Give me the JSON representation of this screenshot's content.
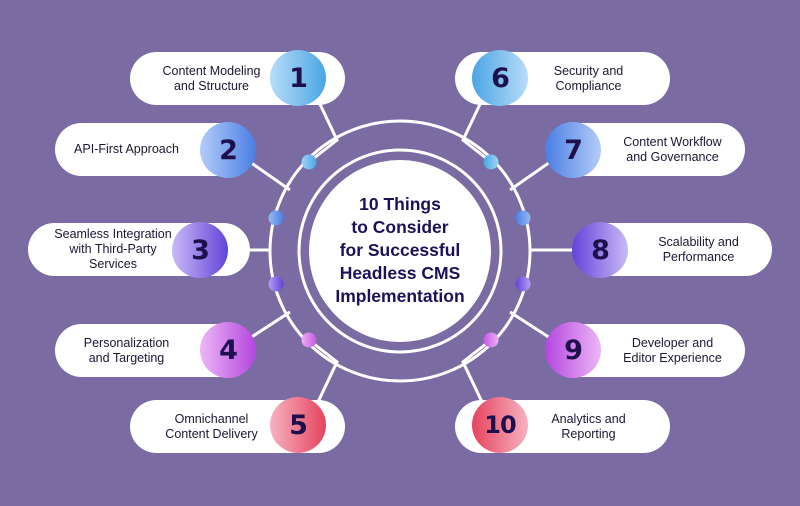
{
  "title": {
    "lines": [
      "10 Things",
      "to Consider",
      "for Successful",
      "Headless CMS",
      "Implementation"
    ]
  },
  "colors": {
    "background": "#7a6ba2",
    "title_text": "#1e1058",
    "number_text": "#1e0f4d",
    "pill": "#ffffff",
    "connector": "#ffffff"
  },
  "items": [
    {
      "number": "1",
      "lines": [
        "Content Modeling",
        "and Structure"
      ],
      "side": "left",
      "gradient": [
        "#b8dcf8",
        "#4aa6e4"
      ]
    },
    {
      "number": "2",
      "lines": [
        "API-First Approach"
      ],
      "side": "left",
      "gradient": [
        "#b4ccf8",
        "#4a7ee4"
      ]
    },
    {
      "number": "3",
      "lines": [
        "Seamless Integration",
        "with Third-Party",
        "Services"
      ],
      "side": "left",
      "gradient": [
        "#c9baf6",
        "#6244d9"
      ]
    },
    {
      "number": "4",
      "lines": [
        "Personalization",
        "and Targeting"
      ],
      "side": "left",
      "gradient": [
        "#ecb6f6",
        "#b446e0"
      ]
    },
    {
      "number": "5",
      "lines": [
        "Omnichannel",
        "Content Delivery"
      ],
      "side": "left",
      "gradient": [
        "#f7b2c2",
        "#e5445e"
      ]
    },
    {
      "number": "6",
      "lines": [
        "Security and",
        "Compliance"
      ],
      "side": "right",
      "gradient": [
        "#4aa6e4",
        "#b8dcf8"
      ]
    },
    {
      "number": "7",
      "lines": [
        "Content Workflow",
        "and Governance"
      ],
      "side": "right",
      "gradient": [
        "#4a7ee4",
        "#b4ccf8"
      ]
    },
    {
      "number": "8",
      "lines": [
        "Scalability and",
        "Performance"
      ],
      "side": "right",
      "gradient": [
        "#6244d9",
        "#c9baf6"
      ]
    },
    {
      "number": "9",
      "lines": [
        "Developer and",
        "Editor Experience"
      ],
      "side": "right",
      "gradient": [
        "#b446e0",
        "#ecb6f6"
      ]
    },
    {
      "number": "10",
      "lines": [
        "Analytics and",
        "Reporting"
      ],
      "side": "right",
      "gradient": [
        "#e5445e",
        "#f7b2c2"
      ]
    }
  ],
  "ring_dots": [
    {
      "gradient": [
        "#9fd4f6",
        "#4aa6e4"
      ]
    },
    {
      "gradient": [
        "#9ab8f4",
        "#4a7ee4"
      ]
    },
    {
      "gradient": [
        "#b09ef2",
        "#6244d9"
      ]
    },
    {
      "gradient": [
        "#eeb0f4",
        "#c356e2"
      ]
    },
    {
      "gradient": [
        "#4aa6e4",
        "#9fd4f6"
      ]
    },
    {
      "gradient": [
        "#4a7ee4",
        "#9ab8f4"
      ]
    },
    {
      "gradient": [
        "#6244d9",
        "#b09ef2"
      ]
    },
    {
      "gradient": [
        "#c356e2",
        "#eeb0f4"
      ]
    }
  ]
}
